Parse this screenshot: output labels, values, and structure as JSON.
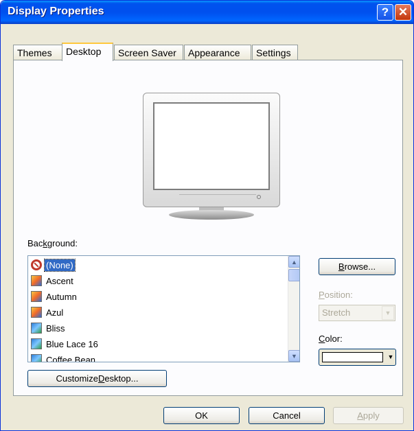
{
  "window": {
    "title": "Display Properties",
    "help_glyph": "?",
    "close_glyph": "✕"
  },
  "tabs": [
    {
      "label": "Themes",
      "active": false
    },
    {
      "label": "Desktop",
      "active": true
    },
    {
      "label": "Screen Saver",
      "active": false
    },
    {
      "label": "Appearance",
      "active": false
    },
    {
      "label": "Settings",
      "active": false
    }
  ],
  "background": {
    "label_pre": "Bac",
    "label_key": "k",
    "label_post": "ground:",
    "items": [
      {
        "label": "(None)",
        "icon": "none-icon",
        "selected": true
      },
      {
        "label": "Ascent",
        "icon": "image-icon",
        "selected": false
      },
      {
        "label": "Autumn",
        "icon": "image-icon",
        "selected": false
      },
      {
        "label": "Azul",
        "icon": "image-icon",
        "selected": false
      },
      {
        "label": "Bliss",
        "icon": "bliss-image-icon",
        "selected": false
      },
      {
        "label": "Blue Lace 16",
        "icon": "bliss-image-icon",
        "selected": false
      },
      {
        "label": "Coffee Bean",
        "icon": "bliss-image-icon",
        "selected": false
      }
    ],
    "scroll_up": "▲",
    "scroll_down": "▼"
  },
  "browse": {
    "label_key": "B",
    "label_post": "rowse..."
  },
  "position": {
    "label_key": "P",
    "label_post": "osition:",
    "value": "Stretch",
    "arrow": "▼",
    "enabled": false
  },
  "color": {
    "label_key": "C",
    "label_post": "olor:",
    "swatch": "#ffffff",
    "arrow": "▼"
  },
  "customize": {
    "label_pre": "Customize ",
    "label_key": "D",
    "label_post": "esktop..."
  },
  "footer": {
    "ok": "OK",
    "cancel": "Cancel",
    "apply_key": "A",
    "apply_post": "pply",
    "apply_enabled": false
  }
}
